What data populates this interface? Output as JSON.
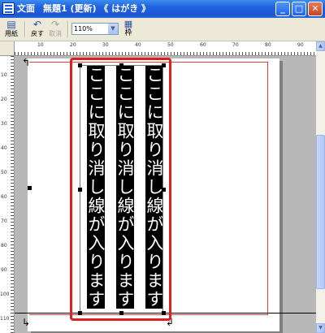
{
  "window": {
    "app_title": "文面",
    "doc_title": "無題1 (更新) 《 はがき 》",
    "controls": {
      "minimize": "_",
      "maximize": "□",
      "close": "✕"
    }
  },
  "toolbar": {
    "print_label": "用紙",
    "undo_label": "戻す",
    "cancel_label": "取消",
    "zoom_value": "110%",
    "frame_label": "枠"
  },
  "ruler": {
    "top_ticks": [
      "10",
      "20",
      "30",
      "40",
      "50",
      "60",
      "70",
      "80",
      "90"
    ],
    "left_ticks": [
      "10",
      "20",
      "30",
      "40",
      "50",
      "60",
      "70",
      "80",
      "90",
      "100",
      "110"
    ]
  },
  "document": {
    "columns": [
      "ここに取り消し線が入ります",
      "ここに取り消し線が入ります",
      "ここに取り消し線が入ります"
    ]
  },
  "colors": {
    "title_bar": "#1f62de",
    "selection_outline": "#e02020",
    "margin_line": "#e04040",
    "text_highlight": "#000000"
  }
}
